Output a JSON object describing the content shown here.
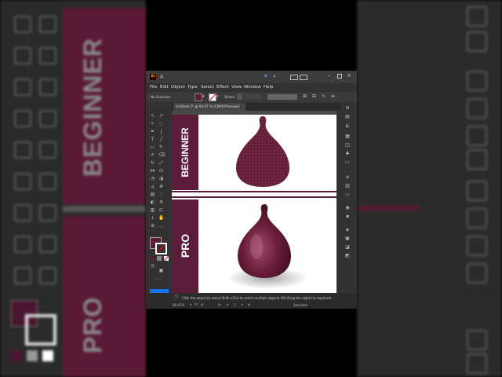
{
  "background": {
    "left_labels": [
      "BEGINNER",
      "PRO"
    ]
  },
  "app": {
    "logo": "Ai",
    "menu": [
      "File",
      "Edit",
      "Object",
      "Type",
      "Select",
      "Effect",
      "View",
      "Window",
      "Help"
    ],
    "control_bar": {
      "selection": "No Selection",
      "stroke_label": "Stroke:"
    },
    "document_tab": "Untitled-1* @ 66.67 % (CMYK/Preview)",
    "artboard": {
      "top_label": "BEGINNER",
      "bottom_label": "PRO"
    },
    "status": {
      "tip": "Click the object to select  Shift+Click to select multiple objects  Alt+Drag the object to duplicate"
    },
    "bottom": {
      "zoom": "66.67%",
      "rotate": "0°",
      "artboard_num": "1",
      "tool": "Selection"
    },
    "colors": {
      "accent": "#5c1d3a",
      "fig": "#6b1e3a",
      "ui_bg": "#323232"
    }
  }
}
